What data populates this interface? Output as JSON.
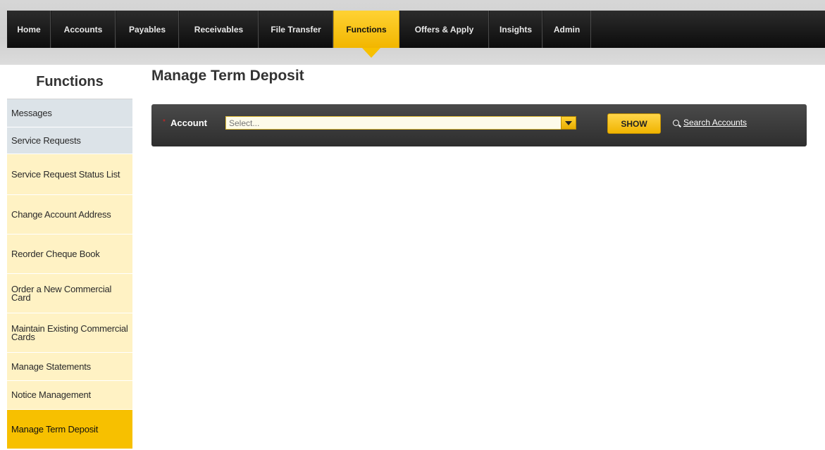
{
  "nav": {
    "items": [
      {
        "label": "Home"
      },
      {
        "label": "Accounts"
      },
      {
        "label": "Payables"
      },
      {
        "label": "Receivables"
      },
      {
        "label": "File Transfer"
      },
      {
        "label": "Functions",
        "active": true
      },
      {
        "label": "Offers & Apply"
      },
      {
        "label": "Insights"
      },
      {
        "label": "Admin"
      }
    ]
  },
  "sidebar": {
    "title": "Functions",
    "items": [
      {
        "label": "Messages"
      },
      {
        "label": "Service Requests"
      },
      {
        "label": "Service Request Status List"
      },
      {
        "label": "Change Account Address"
      },
      {
        "label": "Reorder Cheque Book"
      },
      {
        "label": "Order a New Commercial Card"
      },
      {
        "label": "Maintain Existing Commercial Cards"
      },
      {
        "label": "Manage Statements"
      },
      {
        "label": "Notice Management"
      },
      {
        "label": "Manage Term Deposit",
        "active": true
      }
    ]
  },
  "main": {
    "title": "Manage Term Deposit",
    "account": {
      "required_mark": "*",
      "label": "Account",
      "placeholder": "Select...",
      "show_label": "SHOW",
      "search_label": "Search Accounts"
    }
  },
  "colors": {
    "accent": "#f7c000",
    "nav_bg": "#111111",
    "sidebar_grey": "#dce3e8",
    "sidebar_yellow": "#fff2c4"
  }
}
